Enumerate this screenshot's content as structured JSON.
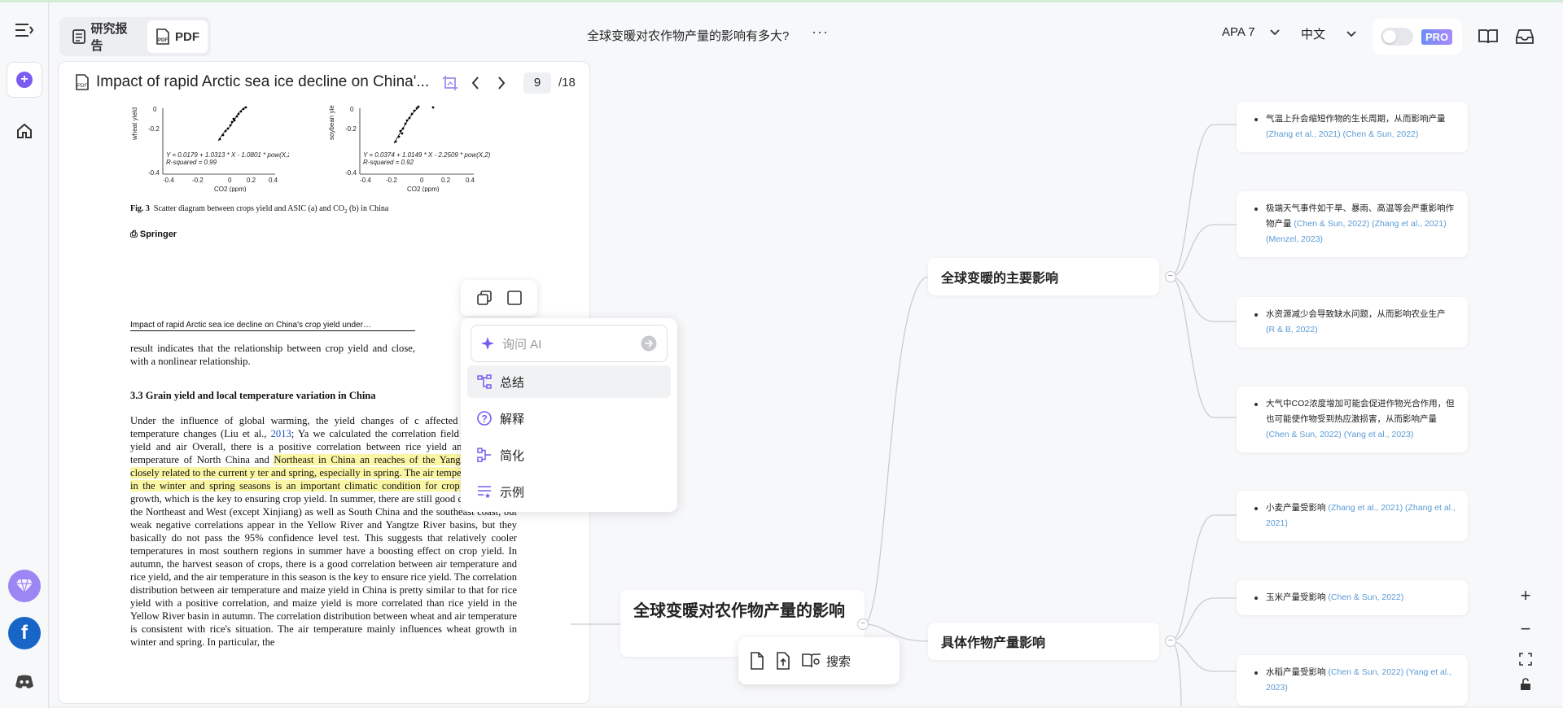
{
  "topbar": {
    "tab_report": "研究报告",
    "tab_pdf": "PDF",
    "title": "全球变暖对农作物产量的影响有多大?",
    "more": "···",
    "citation_style": "APA 7",
    "language": "中文",
    "pro_badge": "PRO"
  },
  "pdf": {
    "title": "Impact of rapid Arctic sea ice decline on China'...",
    "page": "9",
    "total": "/18",
    "fig_caption_bold": "Fig. 3",
    "fig_caption": "Scatter diagram between crops yield and ASIC (a) and CO",
    "fig_caption_tail": " (b) in China",
    "publisher": "Springer",
    "running_header": "Impact of rapid Arctic sea ice decline on China's crop yield under…",
    "p1": "result indicates that the relationship between crop yield and close, with a nonlinear relationship.",
    "section": "3.3  Grain yield and local temperature variation in China",
    "p2a": "Under the influence of global warming, the yield changes of c affected by local air temperature changes (Liu et al., ",
    "p2a_year": "2013",
    "p2b": "; Ya we calculated the correlation field between rice yield and air Overall, there is a positive correlation between rice yield and ai The air temperature of North China and ",
    "p2_hl": "Northeast in China an reaches of the Yangtze River are closely related to the current y ter and spring, especially in spring. The air temperature change in the winter and spring seasons is an important climatic condition for crop planting",
    "p2c": " and growth, which is the key to ensuring crop yield. In summer, there are still good correlations in the Northeast and West (except Xinjiang) as well as South China and the southeast coast, but weak negative correlations appear in the Yellow River and Yangtze River basins, but they basically do not pass the 95% confidence level test. This suggests that relatively cooler temperatures in most southern regions in summer have a boosting effect on crop yield. In autumn, the harvest season of crops, there is a good correlation between air temperature and rice yield, and the air temperature in this season is the key to ensure rice yield. The correlation distribution between air temperature and maize yield in China is pretty similar to that for rice yield with a positive correlation, and maize yield is more correlated than rice yield in the Yellow River basin in autumn. The correlation distribution between wheat and air temperature is consistent with rice's situation. The air temperature mainly influences wheat growth in winter and spring. In particular, the",
    "plots": [
      {
        "ylabel": "wheat yield",
        "eq": "Y = 0.0179 + 1.0313 * X - 1.0801 * pow(X,2)",
        "r2": "R-squared = 0.99",
        "xlabel": "CO2 (ppm)",
        "yticks": [
          "0",
          "-0.2",
          "-0.4"
        ],
        "xticks": [
          "-0.4",
          "-0.2",
          "0",
          "0.2",
          "0.4"
        ]
      },
      {
        "ylabel": "soybean yie",
        "eq": "Y = 0.0374 + 1.0149 * X - 2.2509 * pow(X,2)",
        "r2": "R-squared = 0.92",
        "xlabel": "CO2 (ppm)",
        "yticks": [
          "0",
          "-0.2",
          "-0.4"
        ],
        "xticks": [
          "-0.4",
          "-0.2",
          "0",
          "0.2",
          "0.4"
        ]
      }
    ]
  },
  "popup": {
    "ask_placeholder": "询问 AI",
    "items": [
      "总结",
      "解释",
      "简化",
      "示例"
    ]
  },
  "mindmap": {
    "root": "全球变暖对农作物产量的影响",
    "branch1": "全球变暖的主要影响",
    "branch2": "具体作物产量影响",
    "leaves": [
      {
        "text": "气温上升会缩短作物的生长周期，从而影响产量",
        "cite": "(Zhang et al., 2021) (Chen & Sun, 2022)"
      },
      {
        "text": "极端天气事件如干旱、暴雨、高温等会严重影响作物产量",
        "cite": "(Chen & Sun, 2022) (Zhang et al., 2021) (Menzel, 2023)"
      },
      {
        "text": "水资源减少会导致缺水问题，从而影响农业生产",
        "cite": "(R & B, 2022)"
      },
      {
        "text": "大气中CO2浓度增加可能会促进作物光合作用，但也可能使作物受到热应激损害，从而影响产量",
        "cite": "(Chen & Sun, 2022) (Yang et al., 2023)"
      },
      {
        "text": "小麦产量受影响",
        "cite": "(Zhang et al., 2021) (Zhang et al., 2021)"
      },
      {
        "text": "玉米产量受影响",
        "cite": "(Chen & Sun, 2022)"
      },
      {
        "text": "水稻产量受影响",
        "cite": "(Chen & Sun, 2022) (Yang et al., 2023)"
      }
    ]
  },
  "bottombar": {
    "search": "搜索"
  },
  "zoom": {
    "plus": "+",
    "minus": "−"
  }
}
